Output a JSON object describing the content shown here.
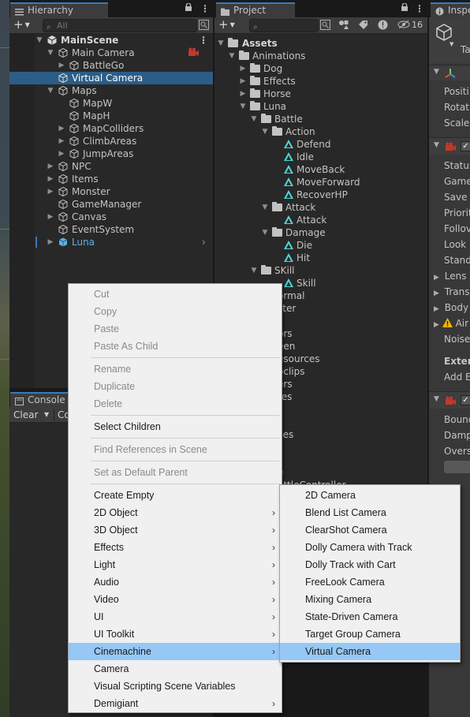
{
  "hierarchy": {
    "tab_label": "Hierarchy",
    "search_placeholder": "All",
    "rows": [
      {
        "label": "MainScene"
      },
      {
        "label": "Main Camera"
      },
      {
        "label": "BattleGo"
      },
      {
        "label": "Virtual Camera"
      },
      {
        "label": "Maps"
      },
      {
        "label": "MapW"
      },
      {
        "label": "MapH"
      },
      {
        "label": "MapColliders"
      },
      {
        "label": "ClimbAreas"
      },
      {
        "label": "JumpAreas"
      },
      {
        "label": "NPC"
      },
      {
        "label": "Items"
      },
      {
        "label": "Monster"
      },
      {
        "label": "GameManager"
      },
      {
        "label": "Canvas"
      },
      {
        "label": "EventSystem"
      },
      {
        "label": "Luna"
      }
    ]
  },
  "project": {
    "tab_label": "Project",
    "hidden_count": "16",
    "rows": [
      {
        "label": "Assets"
      },
      {
        "label": "Animations"
      },
      {
        "label": "Dog"
      },
      {
        "label": "Effects"
      },
      {
        "label": "Horse"
      },
      {
        "label": "Luna"
      },
      {
        "label": "Battle"
      },
      {
        "label": "Action"
      },
      {
        "label": "Defend"
      },
      {
        "label": "Idle"
      },
      {
        "label": "MoveBack"
      },
      {
        "label": "MoveForward"
      },
      {
        "label": "RecoverHP"
      },
      {
        "label": "Attack"
      },
      {
        "label": "Attack"
      },
      {
        "label": "Damage"
      },
      {
        "label": "Die"
      },
      {
        "label": "Hit"
      },
      {
        "label": "SKill"
      },
      {
        "label": "Skill"
      }
    ],
    "partial_rows": [
      "ormal",
      "ster",
      "",
      "ors",
      "een",
      "esources",
      "oclips",
      "ers",
      "tes",
      "",
      "s",
      "ces",
      "s",
      "",
      "e",
      "attleController"
    ]
  },
  "inspector": {
    "tab_label": "Inspe",
    "tag_partial": "Ta",
    "rows": [
      "Positi",
      "Rotati",
      "Scale",
      "Status",
      "Game",
      "Save",
      "Priorit",
      "Follov",
      "Look",
      "Stand",
      "Lens (",
      "Trans",
      "Body",
      "Air",
      "Noise",
      "Exten",
      "Add E",
      "Bound",
      "Damp",
      "Overs"
    ]
  },
  "console": {
    "tab_label": "Console",
    "clear_label": "Clear",
    "collapse_partial": "Co"
  },
  "context_menu": {
    "items": [
      {
        "label": "Cut",
        "disabled": true
      },
      {
        "label": "Copy",
        "disabled": true
      },
      {
        "label": "Paste",
        "disabled": true
      },
      {
        "label": "Paste As Child",
        "disabled": true
      },
      {
        "label": "Rename",
        "disabled": true
      },
      {
        "label": "Duplicate",
        "disabled": true
      },
      {
        "label": "Delete",
        "disabled": true
      },
      {
        "label": "Select Children",
        "disabled": false
      },
      {
        "label": "Find References in Scene",
        "disabled": true
      },
      {
        "label": "Set as Default Parent",
        "disabled": true
      },
      {
        "label": "Create Empty",
        "disabled": false
      },
      {
        "label": "2D Object",
        "disabled": false,
        "submenu": true
      },
      {
        "label": "3D Object",
        "disabled": false,
        "submenu": true
      },
      {
        "label": "Effects",
        "disabled": false,
        "submenu": true
      },
      {
        "label": "Light",
        "disabled": false,
        "submenu": true
      },
      {
        "label": "Audio",
        "disabled": false,
        "submenu": true
      },
      {
        "label": "Video",
        "disabled": false,
        "submenu": true
      },
      {
        "label": "UI",
        "disabled": false,
        "submenu": true
      },
      {
        "label": "UI Toolkit",
        "disabled": false,
        "submenu": true
      },
      {
        "label": "Cinemachine",
        "disabled": false,
        "submenu": true,
        "highlighted": true
      },
      {
        "label": "Camera",
        "disabled": false
      },
      {
        "label": "Visual Scripting Scene Variables",
        "disabled": false
      },
      {
        "label": "Demigiant",
        "disabled": false,
        "submenu": true
      }
    ],
    "submenu_glyph": "›"
  },
  "cinemachine_submenu": {
    "items": [
      {
        "label": "2D Camera"
      },
      {
        "label": "Blend List Camera"
      },
      {
        "label": "ClearShot Camera"
      },
      {
        "label": "Dolly Camera with Track"
      },
      {
        "label": "Dolly Track with Cart"
      },
      {
        "label": "FreeLook Camera"
      },
      {
        "label": "Mixing Camera"
      },
      {
        "label": "State-Driven Camera"
      },
      {
        "label": "Target Group Camera"
      },
      {
        "label": "Virtual Camera",
        "highlighted": true
      }
    ]
  },
  "colors": {
    "selection": "#2c5d87",
    "menu_highlight": "#96c8f5",
    "prefab_blue": "#5fb0e8",
    "anim_cyan": "#4fd6d6",
    "camera_red": "#c0392b",
    "warning_yellow": "#f2b705"
  }
}
